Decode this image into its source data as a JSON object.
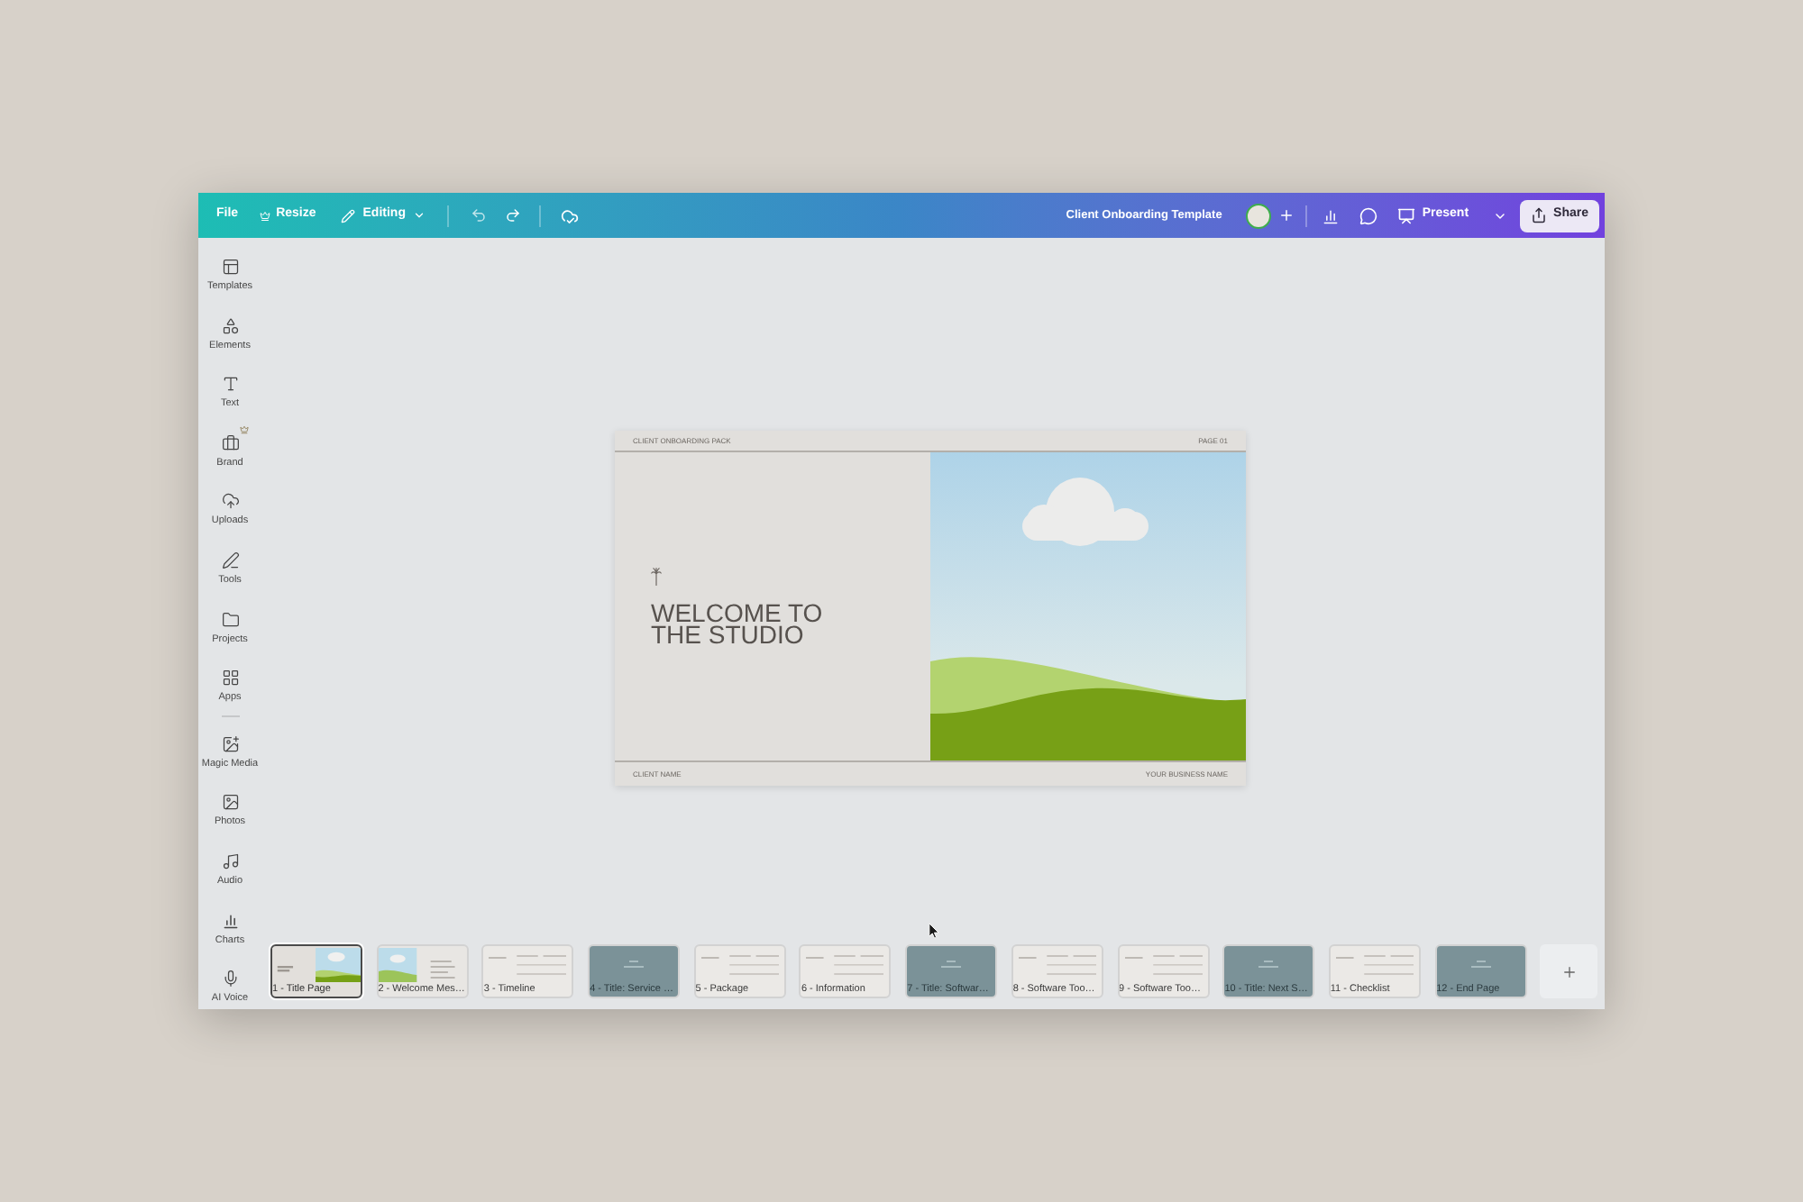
{
  "toolbar": {
    "file": "File",
    "resize": "Resize",
    "editing": "Editing",
    "document_title": "Client Onboarding Template",
    "present": "Present",
    "share": "Share"
  },
  "sidebar": {
    "groups": [
      {
        "items": [
          {
            "label": "Templates",
            "premium": false
          },
          {
            "label": "Elements",
            "premium": false
          },
          {
            "label": "Text",
            "premium": false
          },
          {
            "label": "Brand",
            "premium": true
          },
          {
            "label": "Uploads",
            "premium": false
          },
          {
            "label": "Tools",
            "premium": false
          },
          {
            "label": "Projects",
            "premium": false
          },
          {
            "label": "Apps",
            "premium": false
          }
        ]
      },
      {
        "items": [
          {
            "label": "Magic Media",
            "premium": false
          },
          {
            "label": "Photos",
            "premium": false
          },
          {
            "label": "Audio",
            "premium": false
          },
          {
            "label": "Charts",
            "premium": false
          },
          {
            "label": "AI Voice",
            "premium": false
          }
        ]
      }
    ]
  },
  "slide": {
    "header_left": "CLIENT ONBOARDING PACK",
    "header_right": "PAGE 01",
    "title": "WELCOME TO THE STUDIO",
    "footer_left": "CLIENT NAME",
    "footer_right": "YOUR BUSINESS NAME"
  },
  "pages": [
    {
      "label": "1 - Title Page",
      "selected": true,
      "kind": "cover"
    },
    {
      "label": "2 - Welcome Mes…",
      "selected": false,
      "kind": "intro"
    },
    {
      "label": "3 - Timeline",
      "selected": false,
      "kind": "text"
    },
    {
      "label": "4 - Title: Service …",
      "selected": false,
      "kind": "section"
    },
    {
      "label": "5 - Package",
      "selected": false,
      "kind": "text"
    },
    {
      "label": "6 - Information",
      "selected": false,
      "kind": "text"
    },
    {
      "label": "7 - Title: Softwar…",
      "selected": false,
      "kind": "section"
    },
    {
      "label": "8 - Software Too…",
      "selected": false,
      "kind": "text"
    },
    {
      "label": "9 - Software Too…",
      "selected": false,
      "kind": "text"
    },
    {
      "label": "10 - Title: Next S…",
      "selected": false,
      "kind": "section"
    },
    {
      "label": "11 - Checklist",
      "selected": false,
      "kind": "text"
    },
    {
      "label": "12 - End Page",
      "selected": false,
      "kind": "section"
    }
  ]
}
